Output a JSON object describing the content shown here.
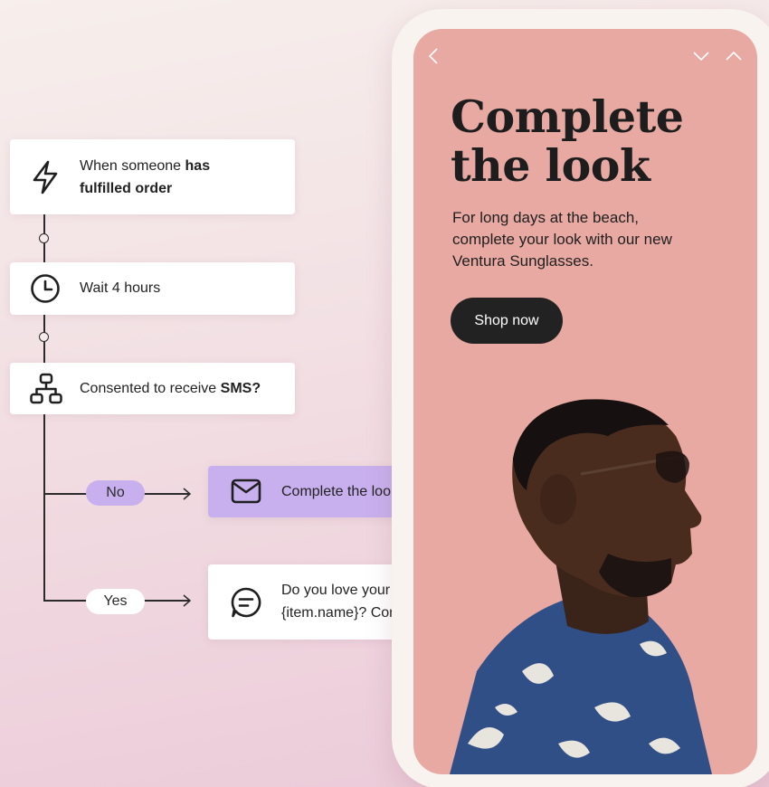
{
  "flow": {
    "trigger": {
      "prefix": "When someone ",
      "bold": "has fulfilled order"
    },
    "wait": {
      "label": "Wait 4 hours"
    },
    "condition": {
      "prefix": "Consented to receive ",
      "bold": "SMS?"
    },
    "branch_no": {
      "label": "No",
      "action": "Complete the look"
    },
    "branch_yes": {
      "label": "Yes",
      "action_line1": "Do you love your",
      "action_line2": "{item.name}? Complete..."
    }
  },
  "phone": {
    "headline_line1": "Complete",
    "headline_line2": "the look",
    "body": "For long days at the beach, complete your look with our new Ventura Sunglasses.",
    "cta": "Shop now",
    "icons": [
      "chevron-left-icon",
      "chevron-down-icon",
      "chevron-up-icon"
    ]
  },
  "colors": {
    "screen_bg": "#e8a9a2",
    "purple_card": "#c8b0ee",
    "cta_bg": "#222222"
  }
}
